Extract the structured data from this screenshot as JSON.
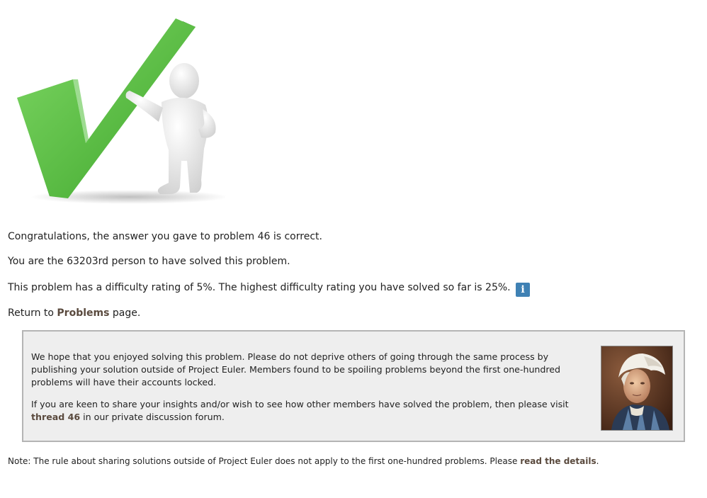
{
  "result": {
    "congrats_text": "Congratulations, the answer you gave to problem 46 is correct.",
    "solver_text": "You are the 63203rd person to have solved this problem.",
    "difficulty_text": "This problem has a difficulty rating of 5%. The highest difficulty rating you have solved so far is 25%.",
    "info_icon": "i",
    "return_prefix": "Return to ",
    "return_link": "Problems",
    "return_suffix": " page."
  },
  "notice": {
    "paragraph1": "We hope that you enjoyed solving this problem. Please do not deprive others of going through the same process by publishing your solution outside of Project Euler. Members found to be spoiling problems beyond the first one-hundred problems will have their accounts locked.",
    "paragraph2_prefix": "If you are keen to share your insights and/or wish to see how other members have solved the problem, then please visit ",
    "thread_link": "thread 46",
    "paragraph2_suffix": " in our private discussion forum."
  },
  "footnote": {
    "prefix": "Note: The rule about sharing solutions outside of Project Euler does not apply to the first one-hundred problems. Please ",
    "link": "read the details",
    "suffix": "."
  },
  "icons": {
    "checkmark": "green-checkmark-figure-icon",
    "info": "info-icon",
    "portrait": "euler-portrait"
  },
  "colors": {
    "checkmark_green": "#4cb63a",
    "info_badge": "#3f81b4",
    "notice_background": "#eeeeee",
    "notice_border": "#b4b4b4",
    "link": "#5a4a3e"
  }
}
